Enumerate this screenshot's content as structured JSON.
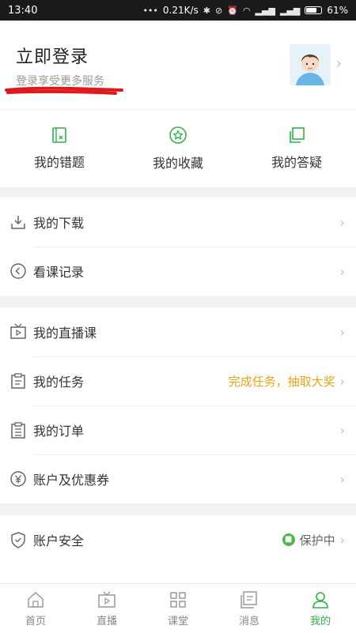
{
  "status_bar": {
    "time": "13:40",
    "network_speed": "0.21K/s",
    "battery": "61%"
  },
  "profile": {
    "title": "立即登录",
    "subtitle": "登录享受更多服务"
  },
  "shortcuts": [
    {
      "label": "我的错题",
      "icon": "wrong-questions-icon"
    },
    {
      "label": "我的收藏",
      "icon": "star-icon"
    },
    {
      "label": "我的答疑",
      "icon": "qa-icon"
    }
  ],
  "menu_group_1": [
    {
      "label": "我的下载",
      "icon": "download-icon"
    },
    {
      "label": "看课记录",
      "icon": "history-icon"
    }
  ],
  "menu_group_2": [
    {
      "label": "我的直播课",
      "icon": "tv-icon"
    },
    {
      "label": "我的任务",
      "icon": "task-icon",
      "right": "完成任务，抽取大奖"
    },
    {
      "label": "我的订单",
      "icon": "order-icon"
    },
    {
      "label": "账户及优惠券",
      "icon": "yen-icon"
    }
  ],
  "menu_group_3": [
    {
      "label": "账户安全",
      "icon": "shield-icon",
      "right": "保护中"
    }
  ],
  "tabbar": [
    {
      "label": "首页",
      "icon": "home-icon"
    },
    {
      "label": "直播",
      "icon": "live-icon"
    },
    {
      "label": "课堂",
      "icon": "grid-icon"
    },
    {
      "label": "消息",
      "icon": "message-icon"
    },
    {
      "label": "我的",
      "icon": "profile-icon",
      "active": true
    }
  ],
  "colors": {
    "accent": "#2db34a",
    "highlight": "#e8a317"
  }
}
